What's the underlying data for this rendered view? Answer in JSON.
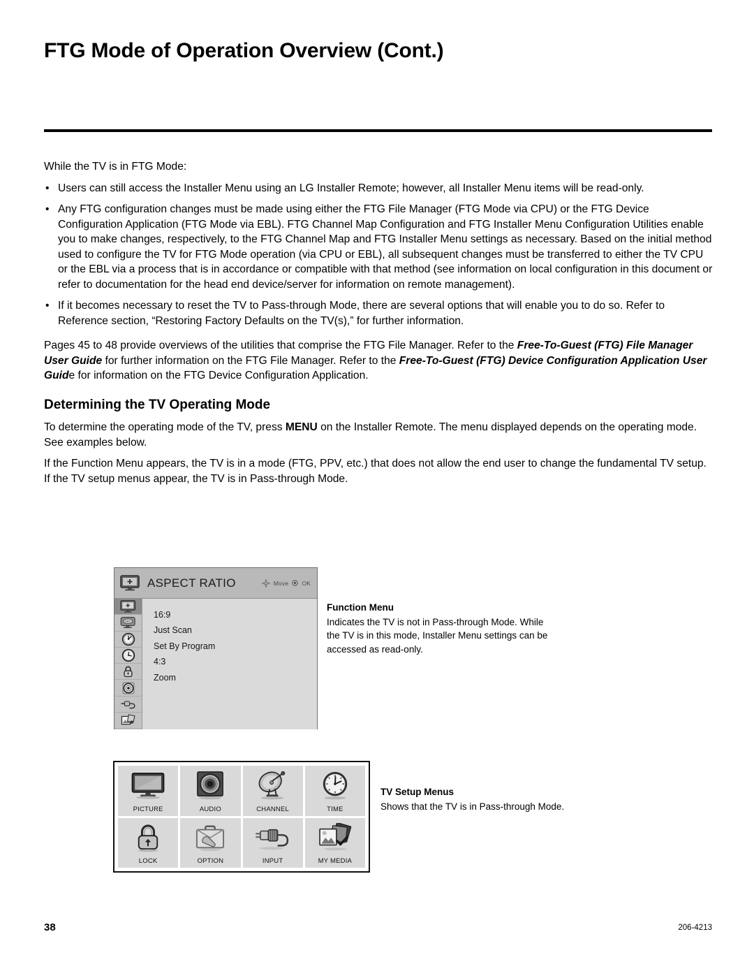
{
  "page": {
    "title": "FTG Mode of Operation Overview (Cont.)",
    "footer_page_number": "38",
    "footer_doc_code": "206-4213"
  },
  "intro": {
    "lead": "While the TV is in FTG Mode:",
    "bullets": [
      "Users can still access the Installer Menu using an LG Installer Remote; however, all Installer Menu items will be read-only.",
      "Any FTG configuration changes must be made using either the FTG File Manager (FTG Mode via CPU) or the FTG Device Configuration Application (FTG Mode via EBL). FTG Channel Map Configuration and FTG Installer Menu Configuration Utilities enable you to make changes, respectively, to the FTG Channel Map and FTG Installer Menu settings as necessary. Based on the initial method used to configure the TV for FTG Mode operation (via CPU or EBL), all subsequent changes must be transferred to either the TV CPU or the EBL via a process that is in accordance or compatible with that method (see information on local configuration in this document or refer to documentation for the head end device/server for information on remote management).",
      "If it becomes necessary to reset the TV to Pass-through Mode, there are several options that will enable you to do so. Refer to Reference section, “Restoring Factory Defaults on the TV(s),” for further information."
    ]
  },
  "guides_para": {
    "part1": "Pages 45 to 48 provide overviews of the utilities that comprise the FTG File Manager. Refer to the ",
    "guide1": "Free-To-Guest (FTG) File Manager User Guide",
    "part2": " for further information on the FTG File Manager. Refer to the ",
    "guide2": "Free-To-Guest (FTG) Device Configuration Application User Guid",
    "guide2_tail": "e",
    "part3": " for information on the FTG Device Configuration Application."
  },
  "section": {
    "heading": "Determining the TV Operating Mode",
    "para1_a": "To determine the operating mode of the TV, press ",
    "para1_menu": "MENU",
    "para1_b": " on the Installer Remote. The menu displayed depends on the operating mode. See examples below.",
    "para2": "If the Function Menu appears, the TV is in a mode (FTG, PPV, etc.) that does not allow the end user to change the fundamental TV setup. If the TV setup menus appear, the TV is in Pass-through Mode."
  },
  "osd": {
    "title": "ASPECT RATIO",
    "hint_move": "Move",
    "hint_ok": "OK",
    "header_icon": "picture-tv-icon",
    "rail_icons": [
      "picture-tv-icon",
      "audio-screen-icon",
      "channel-dial-icon",
      "time-clock-icon",
      "lock-padlock-icon",
      "option-target-icon",
      "input-plug-icon",
      "my-media-photos-icon"
    ],
    "rail_selected_index": 0,
    "items": [
      "16:9",
      "Just Scan",
      "Set By Program",
      "4:3",
      "Zoom"
    ]
  },
  "setup_grid": {
    "cells": [
      {
        "label": "PICTURE",
        "icon": "tv-monitor-icon"
      },
      {
        "label": "AUDIO",
        "icon": "speaker-icon"
      },
      {
        "label": "CHANNEL",
        "icon": "satellite-dish-icon"
      },
      {
        "label": "TIME",
        "icon": "clock-icon"
      },
      {
        "label": "LOCK",
        "icon": "padlock-icon"
      },
      {
        "label": "OPTION",
        "icon": "toolbox-wrench-icon"
      },
      {
        "label": "INPUT",
        "icon": "rca-plug-icon"
      },
      {
        "label": "MY MEDIA",
        "icon": "photos-icon"
      }
    ]
  },
  "callouts": {
    "function_menu": {
      "title": "Function Menu",
      "text": "Indicates the TV is not in Pass-through Mode. While the TV is in this mode, Installer Menu settings can be accessed as read-only."
    },
    "tv_setup_menus": {
      "title": "TV Setup Menus",
      "text": "Shows that the TV is in Pass-through Mode."
    }
  },
  "colors": {
    "osd_header": "#b9b9b9",
    "osd_rail": "#c3c3c3",
    "osd_body": "#dadada",
    "osd_selected": "#8b8b8b",
    "grid_cell": "#d9d9d9",
    "rule": "#000000"
  }
}
